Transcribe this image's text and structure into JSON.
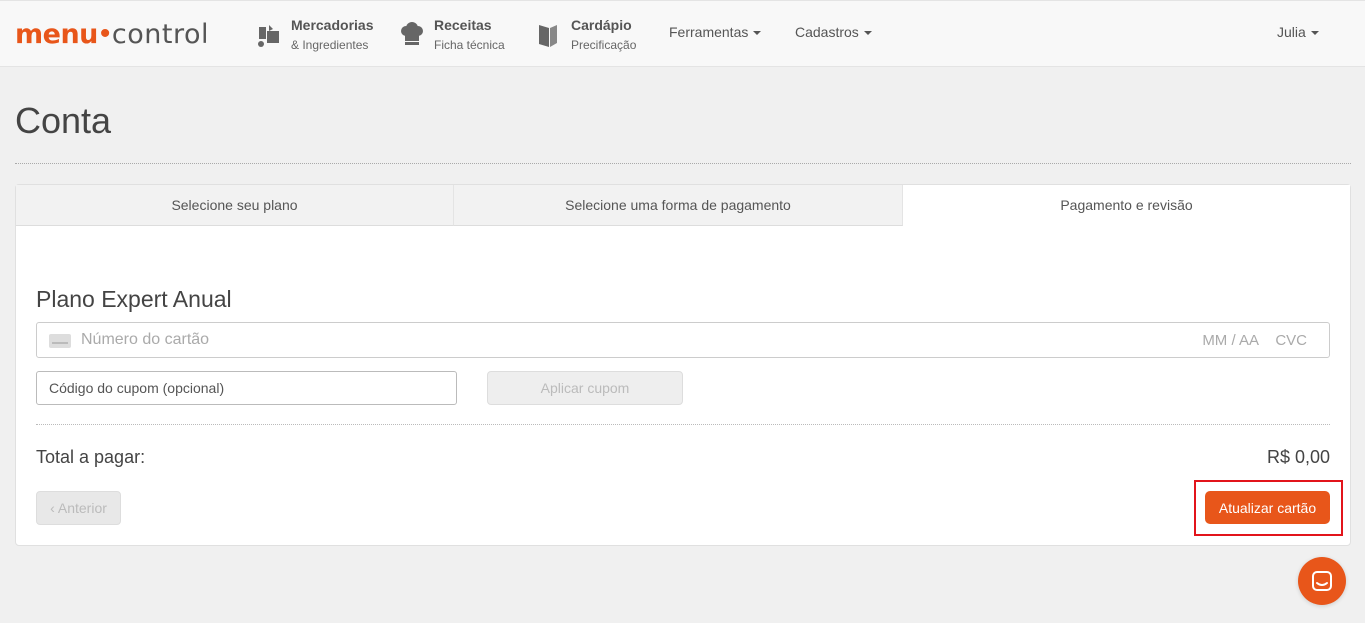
{
  "logo": {
    "menu": "menu",
    "dot": "•",
    "control": "control"
  },
  "nav": {
    "mercadorias": {
      "title": "Mercadorias",
      "subtitle": "& Ingredientes",
      "icon": "ingredients-icon"
    },
    "receitas": {
      "title": "Receitas",
      "subtitle": "Ficha técnica",
      "icon": "chef-hat-icon"
    },
    "cardapio": {
      "title": "Cardápio",
      "subtitle": "Precificação",
      "icon": "menu-book-icon"
    },
    "ferramentas": "Ferramentas",
    "cadastros": "Cadastros",
    "user": "Julia"
  },
  "page": {
    "title": "Conta"
  },
  "tabs": [
    {
      "label": "Selecione seu plano"
    },
    {
      "label": "Selecione uma forma de pagamento"
    },
    {
      "label": "Pagamento e revisão"
    }
  ],
  "form": {
    "plan_title": "Plano Expert Anual",
    "card_placeholder": "Número do cartão",
    "card_expiry_placeholder": "MM / AA",
    "card_cvc_placeholder": "CVC",
    "coupon_placeholder": "Código do cupom (opcional)",
    "apply_coupon": "Aplicar cupom",
    "total_label": "Total a pagar:",
    "total_value": "R$ 0,00",
    "prev_button": "‹ Anterior",
    "update_button": "Atualizar cartão"
  },
  "colors": {
    "brand": "#e8561a",
    "highlight": "#e2141b"
  }
}
